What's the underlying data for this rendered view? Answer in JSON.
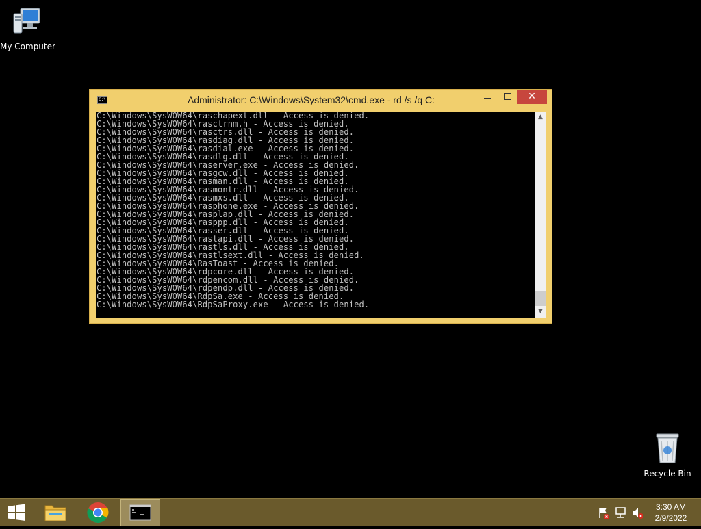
{
  "desktop": {
    "icons": [
      {
        "label": "My Computer",
        "icon": "computer-icon"
      },
      {
        "label": "Recycle Bin",
        "icon": "recycle-bin-icon"
      }
    ]
  },
  "window": {
    "title": "Administrator: C:\\Windows\\System32\\cmd.exe - rd  /s /q C:",
    "icon": "cmd-icon",
    "icon_text": "C:\\",
    "close_label": "✕",
    "lines": [
      "C:\\Windows\\SysWOW64\\raschapext.dll - Access is denied.",
      "C:\\Windows\\SysWOW64\\rasctrnm.h - Access is denied.",
      "C:\\Windows\\SysWOW64\\rasctrs.dll - Access is denied.",
      "C:\\Windows\\SysWOW64\\rasdiag.dll - Access is denied.",
      "C:\\Windows\\SysWOW64\\rasdial.exe - Access is denied.",
      "C:\\Windows\\SysWOW64\\rasdlg.dll - Access is denied.",
      "C:\\Windows\\SysWOW64\\raserver.exe - Access is denied.",
      "C:\\Windows\\SysWOW64\\rasgcw.dll - Access is denied.",
      "C:\\Windows\\SysWOW64\\rasman.dll - Access is denied.",
      "C:\\Windows\\SysWOW64\\rasmontr.dll - Access is denied.",
      "C:\\Windows\\SysWOW64\\rasmxs.dll - Access is denied.",
      "C:\\Windows\\SysWOW64\\rasphone.exe - Access is denied.",
      "C:\\Windows\\SysWOW64\\rasplap.dll - Access is denied.",
      "C:\\Windows\\SysWOW64\\rasppp.dll - Access is denied.",
      "C:\\Windows\\SysWOW64\\rasser.dll - Access is denied.",
      "C:\\Windows\\SysWOW64\\rastapi.dll - Access is denied.",
      "C:\\Windows\\SysWOW64\\rastls.dll - Access is denied.",
      "C:\\Windows\\SysWOW64\\rastlsext.dll - Access is denied.",
      "C:\\Windows\\SysWOW64\\RasToast - Access is denied.",
      "C:\\Windows\\SysWOW64\\rdpcore.dll - Access is denied.",
      "C:\\Windows\\SysWOW64\\rdpencom.dll - Access is denied.",
      "C:\\Windows\\SysWOW64\\rdpendp.dll - Access is denied.",
      "C:\\Windows\\SysWOW64\\RdpSa.exe - Access is denied.",
      "C:\\Windows\\SysWOW64\\RdpSaProxy.exe - Access is denied."
    ]
  },
  "taskbar": {
    "items": [
      "windows-start-icon",
      "file-explorer-icon",
      "chrome-icon",
      "cmd-icon"
    ],
    "tray_icons": [
      "action-center-flag-icon",
      "network-icon",
      "volume-muted-icon"
    ],
    "clock": {
      "time": "3:30 AM",
      "date": "2/9/2022"
    }
  },
  "colors": {
    "window_frame": "#f1cf6d",
    "close_button": "#c7463d",
    "taskbar": "#6a5a2c",
    "console_text": "#c0c0c0"
  }
}
